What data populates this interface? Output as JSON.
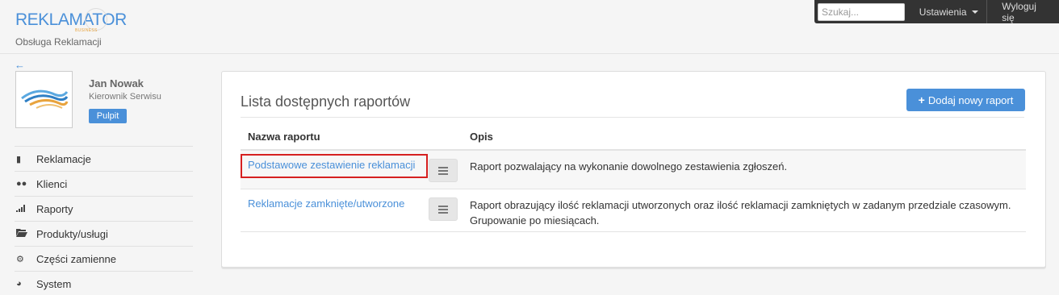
{
  "brand": {
    "logo_main": "REKLAMATOR",
    "logo_sub": "BUSINESS",
    "caption": "Obsługa Reklamacji"
  },
  "topbar": {
    "search_placeholder": "Szukaj...",
    "settings_label": "Ustawienia",
    "logout_label": "Wyloguj się"
  },
  "user": {
    "name": "Jan Nowak",
    "role": "Kierownik Serwisu",
    "dashboard_label": "Pulpit"
  },
  "nav": {
    "items": [
      {
        "label": "Reklamacje",
        "icon": "book-icon"
      },
      {
        "label": "Klienci",
        "icon": "users-icon"
      },
      {
        "label": "Raporty",
        "icon": "signal-bars-icon"
      },
      {
        "label": "Produkty/usługi",
        "icon": "folder-open-icon"
      },
      {
        "label": "Części zamienne",
        "icon": "gear-icon"
      },
      {
        "label": "System",
        "icon": "dashboard-icon"
      }
    ]
  },
  "main": {
    "title": "Lista dostępnych raportów",
    "add_button_label": "Dodaj nowy raport",
    "columns": {
      "name": "Nazwa raportu",
      "description": "Opis"
    },
    "rows": [
      {
        "name": "Podstawowe zestawienie reklamacji",
        "description": "Raport pozwalający na wykonanie dowolnego zestawienia zgłoszeń."
      },
      {
        "name": "Reklamacje zamknięte/utworzone",
        "description": "Raport obrazujący ilość reklamacji utworzonych oraz ilość reklamacji zamkniętych w zadanym przedziale czasowym. Grupowanie po miesiącach."
      }
    ]
  },
  "colors": {
    "accent": "#4a90d9",
    "highlight_border": "#d62020",
    "topbar_bg": "#333333"
  }
}
